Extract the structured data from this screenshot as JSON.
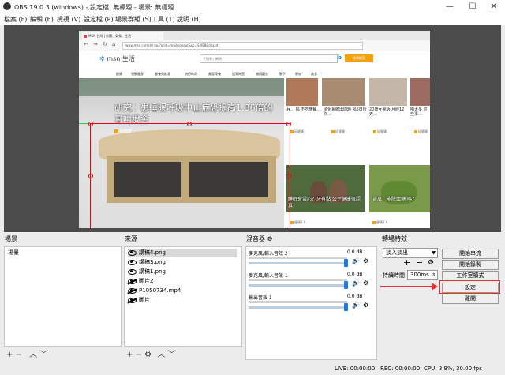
{
  "window": {
    "title": "OBS 19.0.3 (windows) - 設定檔: 無標題 - 場景: 無標題"
  },
  "menu": [
    "檔案 (F)",
    "編輯 (E)",
    "檢視 (V)",
    "設定檔 (P)",
    "場景群組 (S)",
    "工具 (T)",
    "說明 (H)"
  ],
  "preview": {
    "browser_tab": "MSN 台灣 | 新聞、氣象、生活",
    "address": "www.msn.com/zh-tw/?ocid=mailsignout&pc=SMS8&dbxsd",
    "brand": "msn 生活",
    "search_placeholder": "「搜尋」網頁",
    "bing_label": "b",
    "search_button": "搜尋網頁",
    "categories": [
      "健康",
      "運動健身",
      "營養與飲食",
      "流行時尚",
      "美容保養",
      "居家佈置",
      "婚姻觀念",
      "親子",
      "寵物",
      "美食"
    ],
    "hero_title": "研究：患睡眠呼吸中止症恐提高1.36倍的耳鳴機會",
    "hero_source": "好健康",
    "tiles": [
      {
        "cap": "兵…\n揭 不吃晚餐…",
        "src": "好健康"
      },
      {
        "cap": "消化系統出問題\n揭5日後你…",
        "src": "好健康"
      },
      {
        "cap": "20歲女哭訴\n月經12天…",
        "src": "好健康"
      },
      {
        "cap": "喝太多\n這些事…",
        "src": "好健康"
      },
      {
        "cap": "睡眠會當心？牙有點\n公主健康很認真",
        "src": "健康2.0"
      },
      {
        "cap": "苦瓜，能降血糖\n嗎？",
        "src": "健康2.0"
      }
    ]
  },
  "docks": {
    "scenes": {
      "title": "場景",
      "items": [
        "場景"
      ]
    },
    "sources": {
      "title": "來源",
      "items": [
        {
          "name": "講稿4.png",
          "visible": true
        },
        {
          "name": "講稿3.png",
          "visible": true
        },
        {
          "name": "講稿1.png",
          "visible": true
        },
        {
          "name": "圖片2",
          "visible": false
        },
        {
          "name": "P1050734.mp4",
          "visible": false
        },
        {
          "name": "圖片",
          "visible": false
        }
      ]
    },
    "mixer": {
      "title": "混音器",
      "channels": [
        {
          "name": "麥克風/輸入音效 2",
          "db": "0.0 dB"
        },
        {
          "name": "麥克風/輸入音效 1",
          "db": "0.0 dB"
        },
        {
          "name": "輸出音效 1",
          "db": "0.0 dB"
        }
      ]
    },
    "transitions": {
      "title": "轉場特效",
      "selected": "淡入淡出",
      "duration_label": "持續時間",
      "duration_value": "300ms"
    },
    "controls": {
      "start_stream": "開始串流",
      "start_record": "開始錄製",
      "studio_mode": "工作室模式",
      "settings": "設定",
      "exit": "離開"
    }
  },
  "status": {
    "live": "LIVE: 00:00:00",
    "rec": "REC: 00:00:00",
    "cpu": "CPU: 3.9%, 30.00 fps"
  },
  "colors": {
    "accent_blue": "#1e7be0",
    "annotation_red": "#e53333",
    "preview_bg": "#4c4c4c"
  },
  "icons": {
    "gear": "⚙",
    "speaker": "🔊",
    "plus": "+",
    "minus": "−",
    "up": "︿",
    "down": "﹀"
  }
}
